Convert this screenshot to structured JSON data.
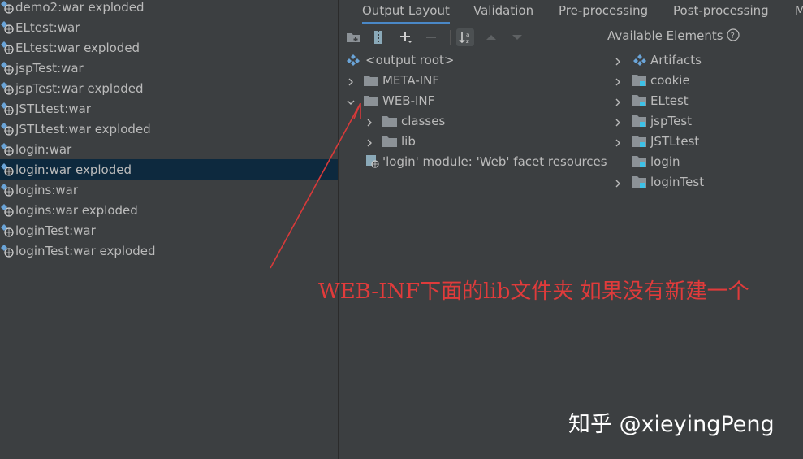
{
  "artifacts": {
    "items": [
      {
        "label": "demo2:war exploded",
        "selected": false
      },
      {
        "label": "ELtest:war",
        "selected": false
      },
      {
        "label": "ELtest:war exploded",
        "selected": false
      },
      {
        "label": "jspTest:war",
        "selected": false
      },
      {
        "label": "jspTest:war exploded",
        "selected": false
      },
      {
        "label": "JSTLtest:war",
        "selected": false
      },
      {
        "label": "JSTLtest:war exploded",
        "selected": false
      },
      {
        "label": "login:war",
        "selected": false
      },
      {
        "label": "login:war exploded",
        "selected": true
      },
      {
        "label": "logins:war",
        "selected": false
      },
      {
        "label": "logins:war exploded",
        "selected": false
      },
      {
        "label": "loginTest:war",
        "selected": false
      },
      {
        "label": "loginTest:war exploded",
        "selected": false
      }
    ]
  },
  "tabs": [
    {
      "label": "Output Layout",
      "active": true
    },
    {
      "label": "Validation",
      "active": false
    },
    {
      "label": "Pre-processing",
      "active": false
    },
    {
      "label": "Post-processing",
      "active": false
    },
    {
      "label": "M",
      "active": false
    }
  ],
  "toolbar": {
    "icons": [
      "new-folder-icon",
      "archive-icon",
      "add-icon",
      "remove-icon",
      "sort-icon",
      "move-up-icon",
      "move-down-icon"
    ]
  },
  "output_tree": {
    "root_label": "<output root>",
    "meta_inf": "META-INF",
    "web_inf": "WEB-INF",
    "classes": "classes",
    "lib": "lib",
    "facet": "'login' module: 'Web' facet resources"
  },
  "available": {
    "title": "Available Elements",
    "items": [
      {
        "label": "Artifacts",
        "kind": "artifacts"
      },
      {
        "label": "cookie",
        "kind": "module"
      },
      {
        "label": "ELtest",
        "kind": "module"
      },
      {
        "label": "jspTest",
        "kind": "module"
      },
      {
        "label": "JSTLtest",
        "kind": "module"
      },
      {
        "label": "login",
        "kind": "module"
      },
      {
        "label": "loginTest",
        "kind": "module"
      }
    ]
  },
  "annotation": {
    "text": "WEB-INF下面的lib文件夹 如果没有新建一个",
    "color": "#e03b3b"
  },
  "watermark": "知乎 @xieyingPeng",
  "colors": {
    "background": "#3c3f41",
    "selected_row": "#0d293e",
    "text": "#bbbbbb",
    "tab_underline": "#4a88c7",
    "folder": "#8c9297",
    "module_badge": "#3ec1e7"
  }
}
